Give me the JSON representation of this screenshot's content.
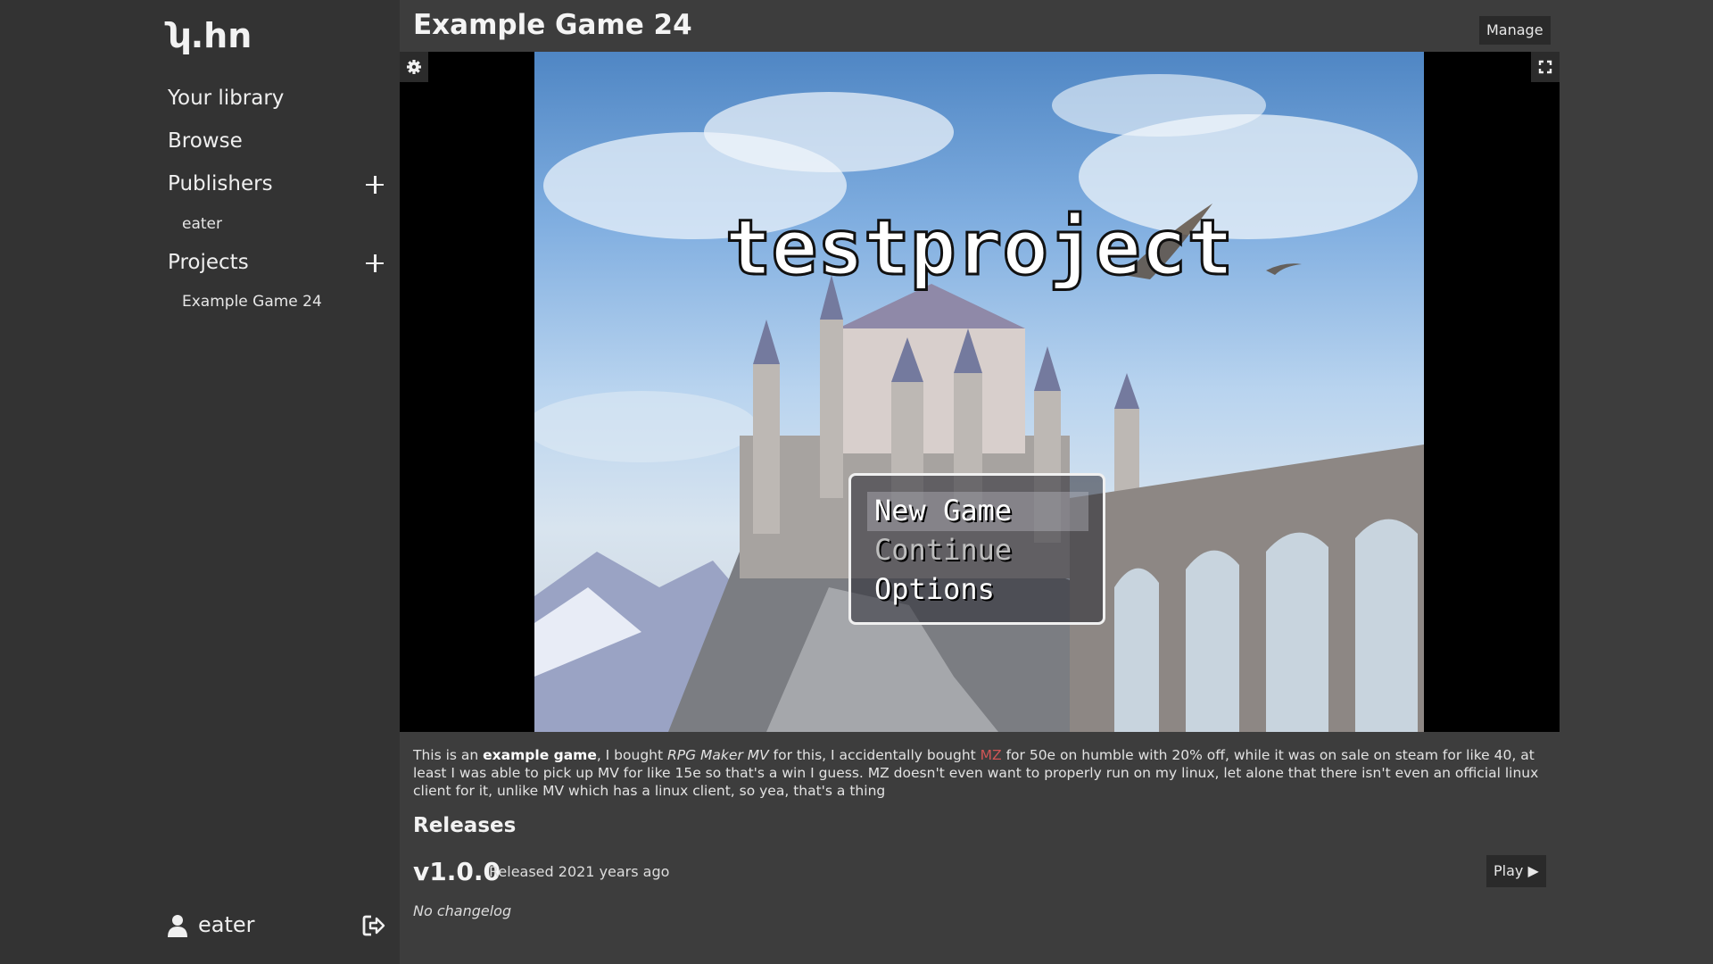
{
  "sidebar": {
    "logo": "ʮ.hn",
    "nav": {
      "library": "Your library",
      "browse": "Browse",
      "publishers": "Publishers",
      "projects": "Projects"
    },
    "publishers": [
      "eater"
    ],
    "projects": [
      "Example Game 24"
    ],
    "user": {
      "name": "eater"
    }
  },
  "main": {
    "title": "Example Game 24",
    "manage_label": "Manage",
    "game": {
      "title": "testproject",
      "menu": [
        "New Game",
        "Continue",
        "Options"
      ],
      "selected_index": 0
    },
    "description": {
      "p1": "This is an ",
      "bold": "example game",
      "p2": ", I bought ",
      "italic": "RPG Maker MV",
      "p3": " for this, I accidentally bought ",
      "link": "MZ",
      "p4": " for 50e on humble with 20% off, while it was on sale on steam for like 40, at least I was able to pick up MV for like 15e so that's a win I guess. MZ doesn't even want to properly run on my linux, let alone that there isn't even an official linux client for it, unlike MV which has a linux client, so yea, that's a thing"
    },
    "releases": {
      "heading": "Releases",
      "items": [
        {
          "version": "v1.0.0",
          "released": "Released 2021 years ago",
          "play_label": "Play",
          "changelog": "No changelog"
        }
      ]
    }
  },
  "colors": {
    "background": "#3d3d3d",
    "sidebar": "#333333",
    "button": "#2a2a2a",
    "link": "#d05555"
  }
}
